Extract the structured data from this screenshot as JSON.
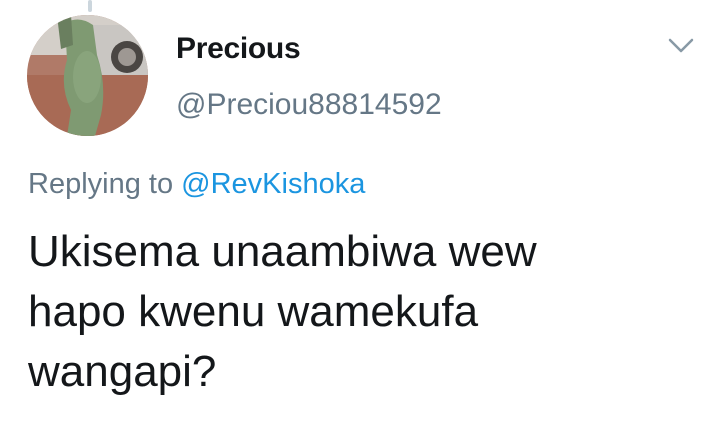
{
  "author": {
    "display_name": "Precious",
    "handle": "@Preciou88814592",
    "avatar_icon": "profile-photo"
  },
  "caret_icon": "chevron-down-icon",
  "reply": {
    "prefix": "Replying to",
    "mention": "@RevKishoka"
  },
  "tweet": {
    "lines": [
      "Ukisema unaambiwa wew",
      "hapo kwenu wamekufa",
      "wangapi?"
    ]
  },
  "colors": {
    "text": "#14171a",
    "secondary": "#657786",
    "link": "#1b95e0",
    "chevron": "#8899a6"
  }
}
